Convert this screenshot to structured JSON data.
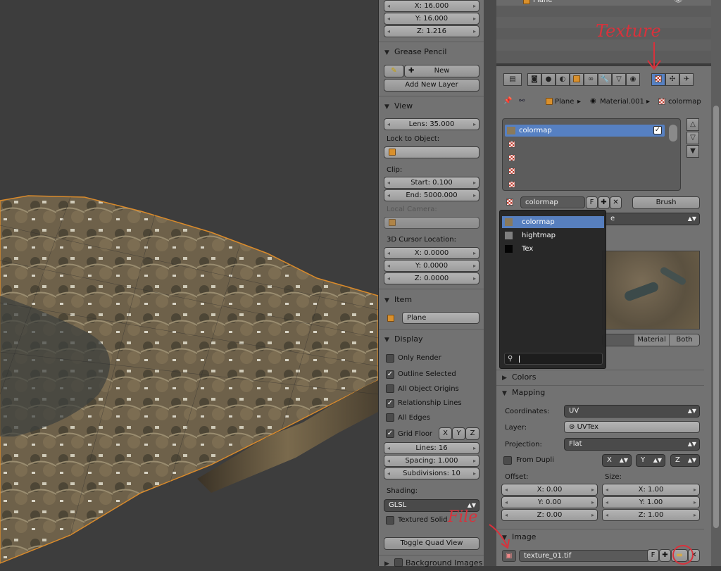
{
  "viewport": {
    "background": "#3d3d3d"
  },
  "npanel": {
    "dims": {
      "x": "X: 16.000",
      "y": "Y: 16.000",
      "z": "Z: 1.216"
    },
    "grease_pencil": {
      "title": "Grease Pencil",
      "new_label": "New",
      "add_layer_label": "Add New Layer"
    },
    "view": {
      "title": "View",
      "lens": "Lens: 35.000",
      "lock_to_object": "Lock to Object:",
      "clip": "Clip:",
      "clip_start": "Start: 0.100",
      "clip_end": "End: 5000.000",
      "local_camera": "Local Camera:",
      "cursor_location": "3D Cursor Location:",
      "cursor_x": "X: 0.0000",
      "cursor_y": "Y: 0.0000",
      "cursor_z": "Z: 0.0000"
    },
    "item": {
      "title": "Item",
      "name": "Plane"
    },
    "display": {
      "title": "Display",
      "only_render": "Only Render",
      "outline_selected": "Outline Selected",
      "all_object_origins": "All Object Origins",
      "relationship_lines": "Relationship Lines",
      "all_edges": "All Edges",
      "grid_floor": "Grid Floor",
      "axis_x": "X",
      "axis_y": "Y",
      "axis_z": "Z",
      "lines": "Lines: 16",
      "spacing": "Spacing: 1.000",
      "subdivisions": "Subdivisions: 10",
      "shading_label": "Shading:",
      "shading_value": "GLSL",
      "textured_solid": "Textured Solid",
      "toggle_quad_view": "Toggle Quad View",
      "background_images": "Background Images"
    }
  },
  "properties": {
    "outliner_item": "Plane",
    "breadcrumb": {
      "object": "Plane",
      "material": "Material.001",
      "texture": "colormap"
    },
    "texture_slots": [
      "colormap",
      "",
      "",
      "",
      ""
    ],
    "texture_name": "colormap",
    "fake_user": "F",
    "brush_label": "Brush",
    "dropdown_items": [
      "colormap",
      "hightmap",
      "Tex"
    ],
    "preview_tabs": {
      "material": "Material",
      "both": "Both"
    },
    "colors_title": "Colors",
    "mapping": {
      "title": "Mapping",
      "coordinates_label": "Coordinates:",
      "coordinates_value": "UV",
      "layer_label": "Layer:",
      "layer_value": "UVTex",
      "projection_label": "Projection:",
      "projection_value": "Flat",
      "from_dupli": "From Dupli",
      "x_axis": "X",
      "y_axis": "Y",
      "z_axis": "Z",
      "offset_label": "Offset:",
      "size_label": "Size:",
      "offset_x": "X: 0.00",
      "offset_y": "Y: 0.00",
      "offset_z": "Z: 0.00",
      "size_x": "X: 1.00",
      "size_y": "Y: 1.00",
      "size_z": "Z: 1.00"
    },
    "image": {
      "title": "Image",
      "filename": "texture_01.tif",
      "fake_user": "F"
    }
  },
  "annotations": {
    "texture": "Texture",
    "file": "File"
  },
  "colors": {
    "highlight": "#5680c2",
    "annotation": "#d8323c",
    "panel": "#727272"
  }
}
